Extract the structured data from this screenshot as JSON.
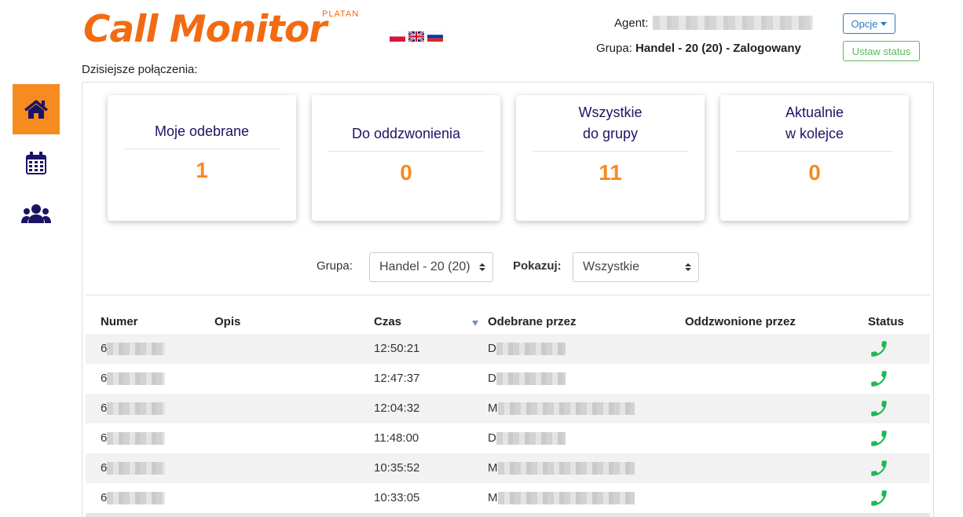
{
  "header": {
    "logo_text": "Call Monitor",
    "logo_sub": "PLATAN",
    "flags": [
      "flag-pl-icon",
      "flag-gb-icon",
      "flag-ru-icon"
    ],
    "agent_label": "Agent:",
    "group_label": "Grupa:",
    "group_value": "Handel - 20 (20) - Zalogowany",
    "options_button": "Opcje",
    "set_status_button": "Ustaw status"
  },
  "today_label": "Dzisiejsze połączenia:",
  "sidebar": {
    "items": [
      {
        "name": "home-icon",
        "active": true
      },
      {
        "name": "calendar-icon",
        "active": false
      },
      {
        "name": "users-icon",
        "active": false
      }
    ]
  },
  "cards": [
    {
      "title_line1": "Moje odebrane",
      "title_line2": "",
      "value": "1"
    },
    {
      "title_line1": "Do oddzwonienia",
      "title_line2": "",
      "value": "0"
    },
    {
      "title_line1": "Wszystkie",
      "title_line2": "do grupy",
      "value": "11"
    },
    {
      "title_line1": "Aktualnie",
      "title_line2": "w kolejce",
      "value": "0"
    }
  ],
  "filters": {
    "group_label": "Grupa:",
    "group_selected": "Handel - 20 (20)",
    "show_label": "Pokazuj:",
    "show_selected": "Wszystkie"
  },
  "table": {
    "columns": [
      "Numer",
      "Opis",
      "Czas",
      "Odebrane przez",
      "Oddzwonione przez",
      "Status"
    ],
    "sorted_column": "Czas",
    "rows": [
      {
        "number_prefix": "6",
        "description": "",
        "time": "12:50:21",
        "agent_prefix": "D",
        "callback": "",
        "status": "phone-answered-icon"
      },
      {
        "number_prefix": "6",
        "description": "",
        "time": "12:47:37",
        "agent_prefix": "D",
        "callback": "",
        "status": "phone-answered-icon"
      },
      {
        "number_prefix": "6",
        "description": "",
        "time": "12:04:32",
        "agent_prefix": "M",
        "callback": "",
        "status": "phone-answered-icon"
      },
      {
        "number_prefix": "6",
        "description": "",
        "time": "11:48:00",
        "agent_prefix": "D",
        "callback": "",
        "status": "phone-answered-icon"
      },
      {
        "number_prefix": "6",
        "description": "",
        "time": "10:35:52",
        "agent_prefix": "M",
        "callback": "",
        "status": "phone-answered-icon"
      },
      {
        "number_prefix": "6",
        "description": "",
        "time": "10:33:05",
        "agent_prefix": "M",
        "callback": "",
        "status": "phone-answered-icon"
      }
    ]
  },
  "colors": {
    "brand_orange": "#f26b12",
    "accent_orange": "#f68b1f",
    "navy": "#1b1464",
    "phone_green": "#1db954",
    "primary_blue": "#2a7ac0",
    "success_green": "#5cb85c"
  }
}
